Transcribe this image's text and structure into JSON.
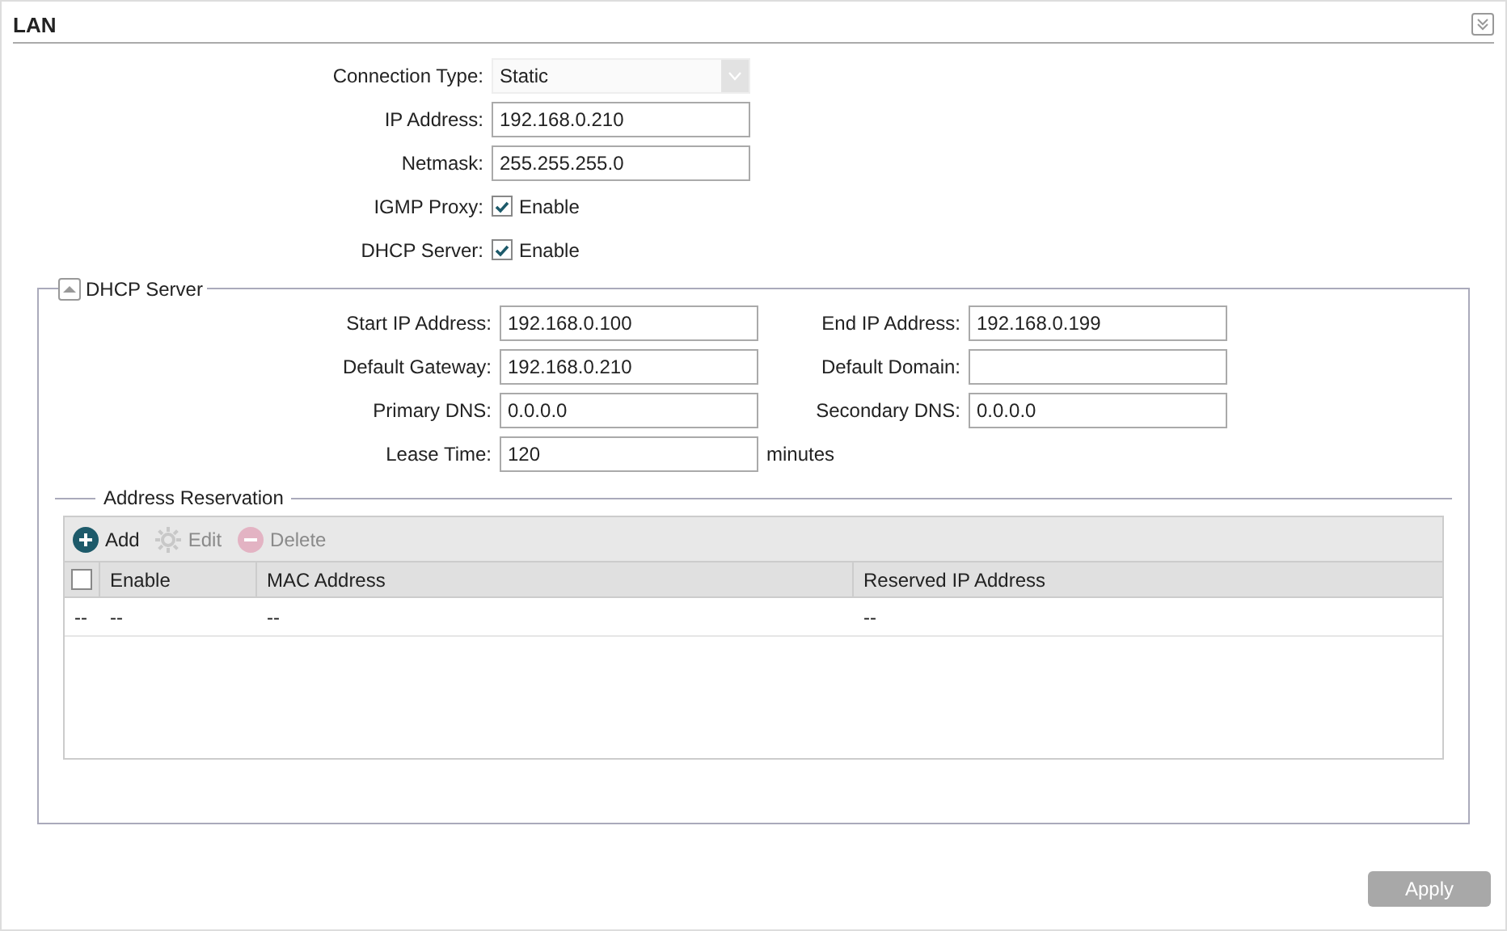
{
  "title": "LAN",
  "fields": [
    {
      "kind": "select",
      "label": "Connection Type:",
      "value": "Static"
    },
    {
      "kind": "text",
      "label": "IP Address:",
      "value": "192.168.0.210"
    },
    {
      "kind": "text",
      "label": "Netmask:",
      "value": "255.255.255.0"
    },
    {
      "kind": "checkbox",
      "label": "IGMP Proxy:",
      "option": "Enable",
      "checked": true
    },
    {
      "kind": "checkbox",
      "label": "DHCP Server:",
      "option": "Enable",
      "checked": true
    }
  ],
  "dhcp": {
    "title": "DHCP Server",
    "expanded": true,
    "rows": [
      {
        "left": {
          "label": "Start IP Address:",
          "value": "192.168.0.100"
        },
        "right": {
          "label": "End IP Address:",
          "value": "192.168.0.199"
        }
      },
      {
        "left": {
          "label": "Default Gateway:",
          "value": "192.168.0.210"
        },
        "right": {
          "label": "Default Domain:"
        }
      },
      {
        "left": {
          "label": "Primary DNS:",
          "value": "0.0.0.0"
        },
        "right": {
          "label": "Secondary DNS:",
          "value": "0.0.0.0"
        }
      },
      {
        "left": {
          "label": "Lease Time:",
          "value": "120",
          "unit": "minutes"
        }
      }
    ],
    "reservation": {
      "title": "Address Reservation",
      "toolbar": [
        {
          "kind": "add",
          "label": "Add",
          "disabled": false
        },
        {
          "kind": "edit",
          "label": "Edit",
          "disabled": true
        },
        {
          "kind": "delete",
          "label": "Delete",
          "disabled": true
        }
      ],
      "columns": [
        {
          "kind": "checkbox",
          "checked": false
        },
        {
          "kind": "text",
          "label": "Enable"
        },
        {
          "kind": "text",
          "label": "MAC Address"
        },
        {
          "kind": "text",
          "label": "Reserved IP Address"
        }
      ],
      "rows": [
        [
          "--",
          "--",
          "--",
          "--"
        ]
      ]
    }
  },
  "apply": {
    "label": "Apply",
    "disabled": true
  }
}
